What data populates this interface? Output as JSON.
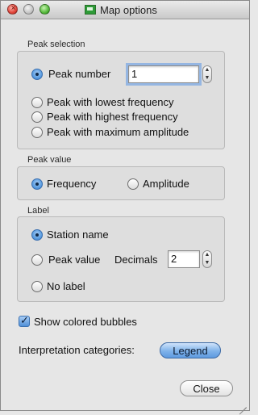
{
  "window": {
    "title": "Map options",
    "icon": "map-icon"
  },
  "peak_selection": {
    "label": "Peak selection",
    "options": [
      {
        "label": "Peak number",
        "selected": true
      },
      {
        "label": "Peak with lowest frequency",
        "selected": false
      },
      {
        "label": "Peak with highest frequency",
        "selected": false
      },
      {
        "label": "Peak with maximum amplitude",
        "selected": false
      }
    ],
    "peak_number_value": "1"
  },
  "peak_value": {
    "label": "Peak value",
    "options": [
      {
        "label": "Frequency",
        "selected": true
      },
      {
        "label": "Amplitude",
        "selected": false
      }
    ]
  },
  "label_group": {
    "label": "Label",
    "options": [
      {
        "label": "Station name",
        "selected": true
      },
      {
        "label": "Peak value",
        "selected": false
      },
      {
        "label": "No label",
        "selected": false
      }
    ],
    "decimals_label": "Decimals",
    "decimals_value": "2"
  },
  "show_colored_bubbles": {
    "label": "Show colored bubbles",
    "checked": true
  },
  "interpretation": {
    "label": "Interpretation categories:",
    "button": "Legend"
  },
  "close_button": "Close",
  "colors": {
    "accent": "#5e9ae0",
    "window_bg": "#e6e6e6"
  }
}
